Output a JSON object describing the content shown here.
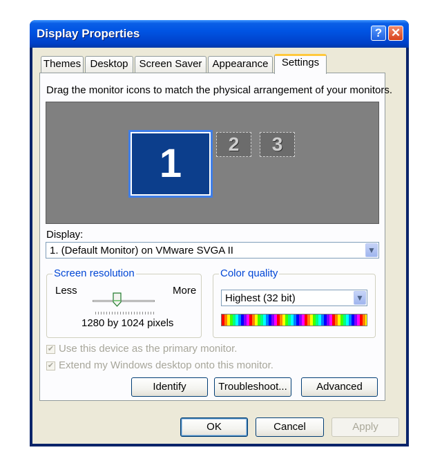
{
  "window": {
    "title": "Display Properties",
    "help_icon": "?",
    "close_icon": "✕"
  },
  "tabs": [
    {
      "label": "Themes",
      "active": false
    },
    {
      "label": "Desktop",
      "active": false
    },
    {
      "label": "Screen Saver",
      "active": false
    },
    {
      "label": "Appearance",
      "active": false
    },
    {
      "label": "Settings",
      "active": true
    }
  ],
  "settings": {
    "instructions": "Drag the monitor icons to match the physical arrangement of your monitors.",
    "monitors": [
      {
        "number": "1",
        "selected": true
      },
      {
        "number": "2",
        "selected": false
      },
      {
        "number": "3",
        "selected": false
      }
    ],
    "display_label": "Display:",
    "display_value": "1. (Default Monitor) on VMware SVGA II",
    "screen_resolution": {
      "title": "Screen resolution",
      "less_label": "Less",
      "more_label": "More",
      "value_text": "1280 by 1024 pixels"
    },
    "color_quality": {
      "title": "Color quality",
      "value": "Highest (32 bit)"
    },
    "primary_monitor_label": "Use this device as the primary monitor.",
    "extend_desktop_label": "Extend my Windows desktop onto this monitor.",
    "identify_label": "Identify",
    "troubleshoot_label": "Troubleshoot...",
    "advanced_label": "Advanced"
  },
  "footer": {
    "ok_label": "OK",
    "cancel_label": "Cancel",
    "apply_label": "Apply"
  },
  "colors": {
    "titlebar": "#0054e3",
    "dialog_bg": "#ece9d8",
    "group_title": "#0046d5",
    "active_tab_accent": "#ffc83c"
  }
}
